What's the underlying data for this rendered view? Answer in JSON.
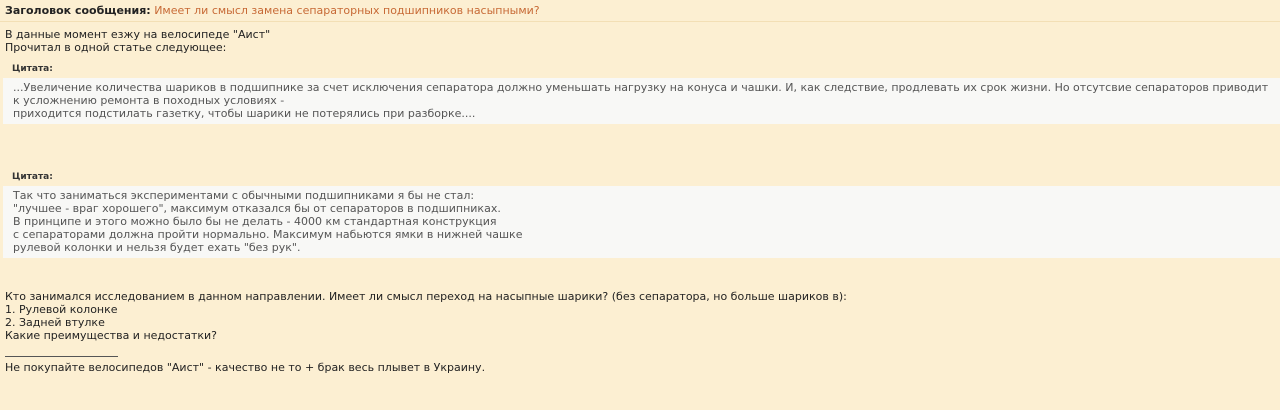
{
  "subject": {
    "label": "Заголовок сообщения:",
    "text": "Имеет ли смысл замена сепараторных подшипников насыпными?"
  },
  "intro": [
    "В данные момент езжу на велосипеде \"Аист\"",
    "Прочитал в одной статье следующее:"
  ],
  "quotes": [
    {
      "label": "Цитата:",
      "lines": [
        "...Увеличение количества шариков в подшипнике за счет исключения сепаратора должно уменьшать нагрузку на конуса и чашки. И, как следствие, продлевать их срок жизни. Но отсутсвие сепараторов приводит к усложнению ремонта в походных условиях -",
        "приходится подстилать газетку, чтобы шарики не потерялись при разборке...."
      ]
    },
    {
      "label": "Цитата:",
      "lines": [
        "Так что заниматься экспериментами с обычными подшипниками я бы не стал:",
        "\"лучшее - враг хорошего\", максимум отказался бы от сепараторов в подшипниках.",
        "В принципе и этого можно было бы не делать - 4000 км стандартная конструкция",
        "с сепараторами должна пройти нормально. Максимум набьются ямки в нижней чашке",
        "рулевой колонки и нельзя будет ехать \"без рук\"."
      ]
    }
  ],
  "question": [
    "Кто занимался исследованием в данном направлении. Имеет ли смысл переход на насыпные шарики? (без сепаратора, но больше шариков в):",
    "1. Рулевой колонке",
    "2. Задней втулке",
    "Какие преимущества и недостатки?"
  ],
  "signature": "Не покупайте велосипедов \"Аист\" - качество не то + брак весь плывет в Украину."
}
